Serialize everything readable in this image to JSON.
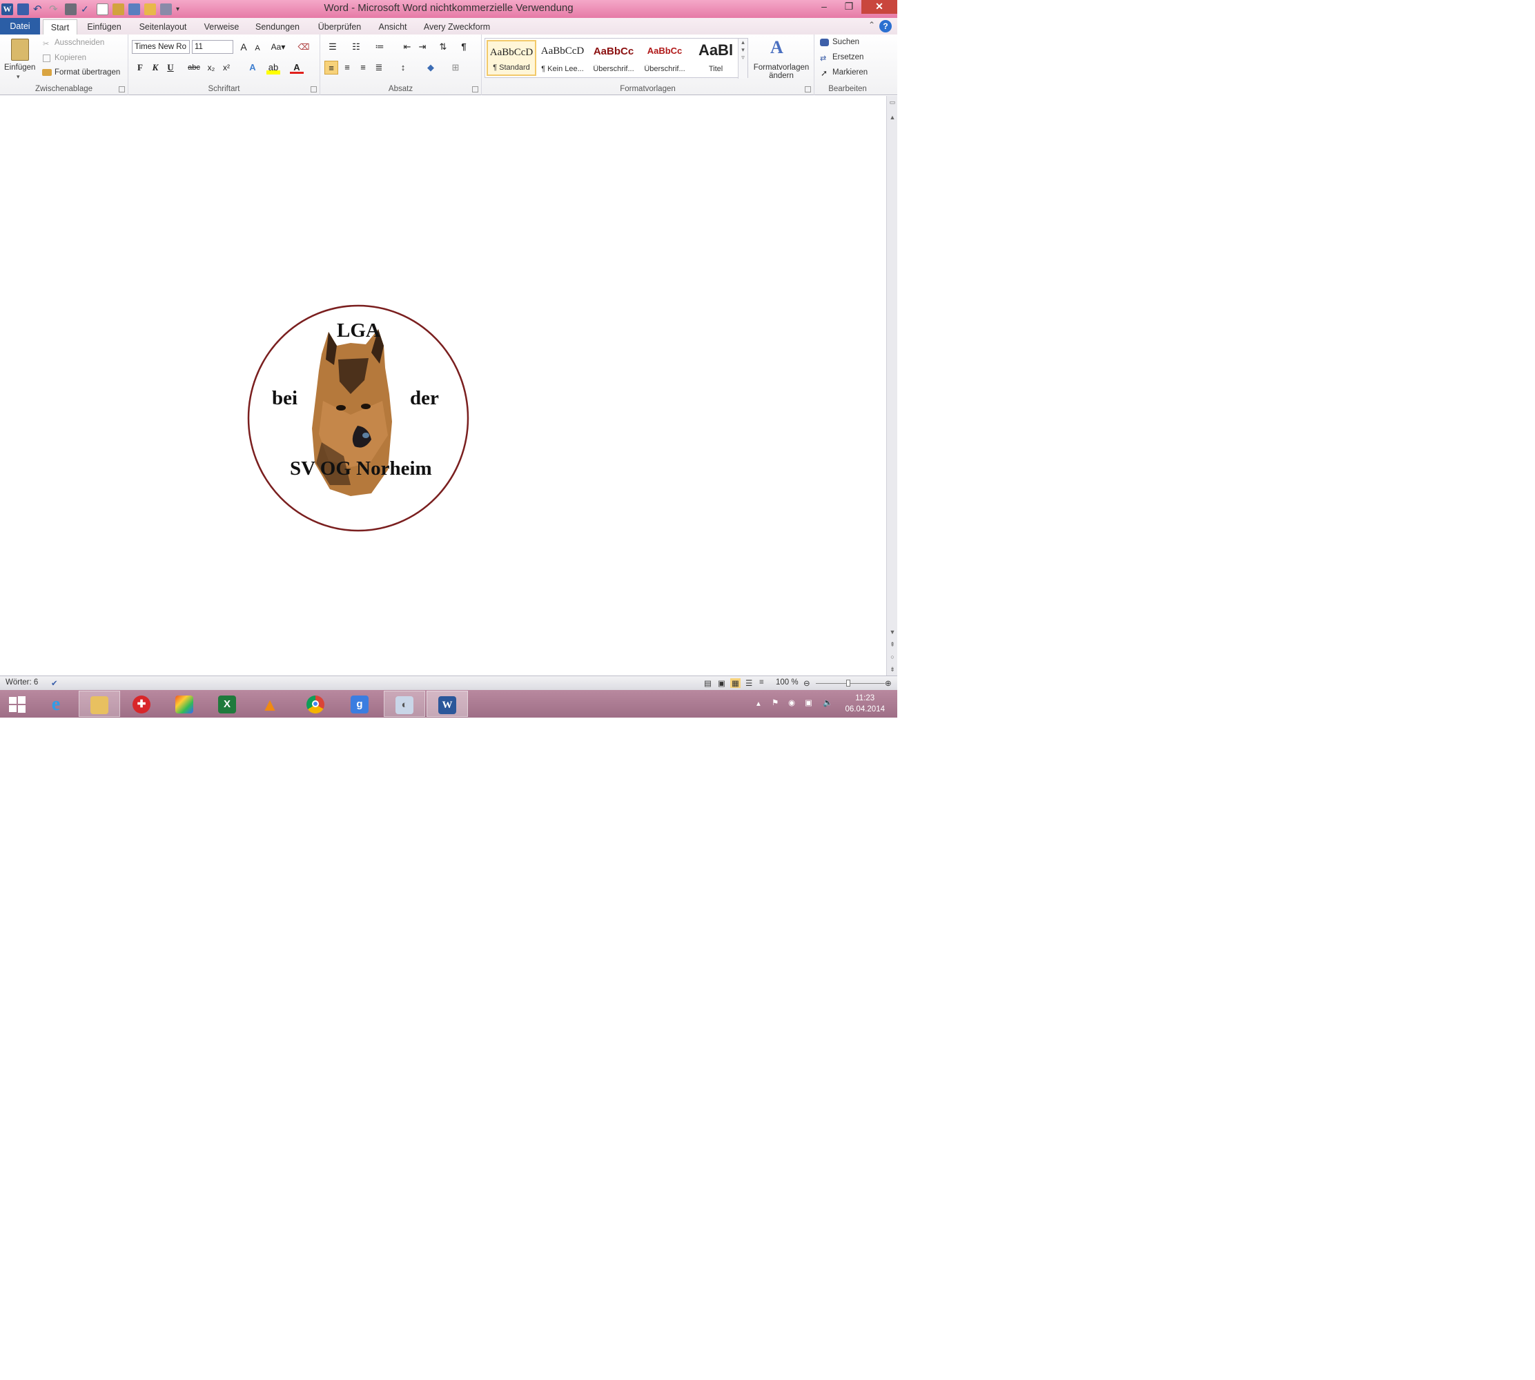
{
  "window": {
    "title": "Word  -  Microsoft Word nichtkommerzielle Verwendung",
    "controls": {
      "minimize": "–",
      "restore": "❐",
      "close": "✕"
    }
  },
  "tabs": {
    "file": "Datei",
    "items": [
      "Start",
      "Einfügen",
      "Seitenlayout",
      "Verweise",
      "Sendungen",
      "Überprüfen",
      "Ansicht",
      "Avery Zweckform"
    ],
    "active": "Start"
  },
  "ribbon": {
    "clipboard": {
      "paste": "Einfügen",
      "cut": "Ausschneiden",
      "copy": "Kopieren",
      "format_painter": "Format übertragen",
      "label": "Zwischenablage"
    },
    "font": {
      "family": "Times New Ro",
      "size": "11",
      "bold": "F",
      "italic": "K",
      "underline": "U",
      "strikethrough": "abc",
      "subscript": "x₂",
      "superscript": "x²",
      "label": "Schriftart"
    },
    "paragraph": {
      "label": "Absatz",
      "pilcrow": "¶"
    },
    "styles": {
      "items": [
        {
          "sample": "AaBbCcD",
          "name": "¶ Standard"
        },
        {
          "sample": "AaBbCcD",
          "name": "¶ Kein Lee..."
        },
        {
          "sample": "AaBbCc",
          "name": "Überschrif..."
        },
        {
          "sample": "AaBbCc",
          "name": "Überschrif..."
        },
        {
          "sample": "AaBl",
          "name": "Titel"
        }
      ],
      "change_styles": "Formatvorlagen ändern",
      "label": "Formatvorlagen"
    },
    "editing": {
      "find": "Suchen",
      "replace": "Ersetzen",
      "select": "Markieren",
      "label": "Bearbeiten"
    }
  },
  "document": {
    "logo": {
      "top": "LGA",
      "left": "bei",
      "right": "der",
      "bottom": "SV OG Norheim",
      "ring_color": "#7a1f1f"
    }
  },
  "statusbar": {
    "words": "Wörter: 6",
    "zoom": "100 %"
  },
  "taskbar": {
    "time": "11:23",
    "date": "06.04.2014"
  },
  "colors": {
    "title_bar": "#e67aa6",
    "file_tab": "#2b5ea6",
    "taskbar": "#a97a92"
  }
}
